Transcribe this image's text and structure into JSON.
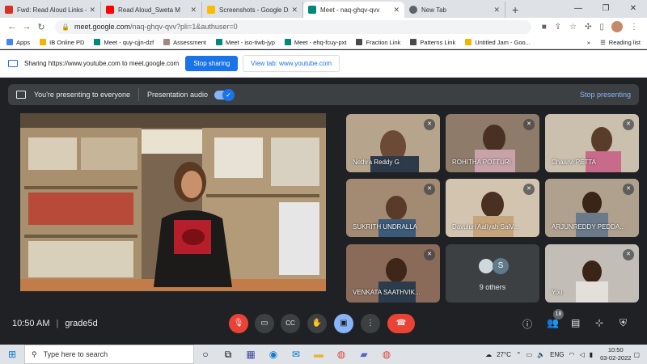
{
  "browser": {
    "tabs": [
      {
        "title": "Fwd: Read Aloud Links - G",
        "color": "#d93025"
      },
      {
        "title": "Read Aloud_Sweta M",
        "color": "#ff0000"
      },
      {
        "title": "Screenshots - Google Dri",
        "color": "#fbbc04"
      },
      {
        "title": "Meet - naq-ghqv-qvv",
        "color": "#00897b"
      },
      {
        "title": "New Tab",
        "color": "#5f6368"
      }
    ],
    "url_host": "meet.google.com",
    "url_path": "/naq-ghqv-qvv?pli=1&authuser=0",
    "bookmarks": [
      {
        "label": "Apps",
        "color": "#4285f4"
      },
      {
        "label": "IB Online PD",
        "color": "#f4b400"
      },
      {
        "label": "Meet - quy-cjjn-dzf",
        "color": "#00897b"
      },
      {
        "label": "Assessment",
        "color": "#a1887f"
      },
      {
        "label": "Meet - iso-tiwb-jyp",
        "color": "#00897b"
      },
      {
        "label": "Meet - ehq-fcuy-pxt",
        "color": "#00897b"
      },
      {
        "label": "Fraction Link",
        "color": "#4a4a4a"
      },
      {
        "label": "Patterns Link",
        "color": "#4a4a4a"
      },
      {
        "label": "Untitled Jam - Goo...",
        "color": "#f4b400"
      }
    ],
    "reading_list": "Reading list"
  },
  "sharing": {
    "text": "Sharing https://www.youtube.com to meet.google.com",
    "stop_label": "Stop sharing",
    "view_label": "View tab: www.youtube.com"
  },
  "meet": {
    "presenting_text": "You're presenting to everyone",
    "audio_label": "Presentation audio",
    "stop_presenting": "Stop presenting",
    "participants": [
      {
        "name": "Nethra Reddy G",
        "bg": "#8a7a68"
      },
      {
        "name": "ROHITHA POTTURI",
        "bg": "#6e5b4d"
      },
      {
        "name": "Chaarvi PETTA",
        "bg": "#9a8a78"
      },
      {
        "name": "SUKRITH UNDRALLA",
        "bg": "#7a6a5a"
      },
      {
        "name": "Davuluri Aaliyah SaiV...",
        "bg": "#a99a86"
      },
      {
        "name": "ARJUNREDDY PEDDA...",
        "bg": "#8b7868"
      },
      {
        "name": "VENKATA SAATHVIK...",
        "bg": "#7d6452"
      },
      {
        "name": "9 others",
        "bg": "#3c4043"
      },
      {
        "name": "You",
        "bg": "#b0aca6"
      }
    ],
    "others_avatar": "S",
    "time": "10:50 AM",
    "meeting_name": "grade5d",
    "participant_count": "18"
  },
  "taskbar": {
    "search_placeholder": "Type here to search",
    "temperature": "27°C",
    "language": "ENG",
    "time": "10:50",
    "date": "03-02-2022"
  }
}
